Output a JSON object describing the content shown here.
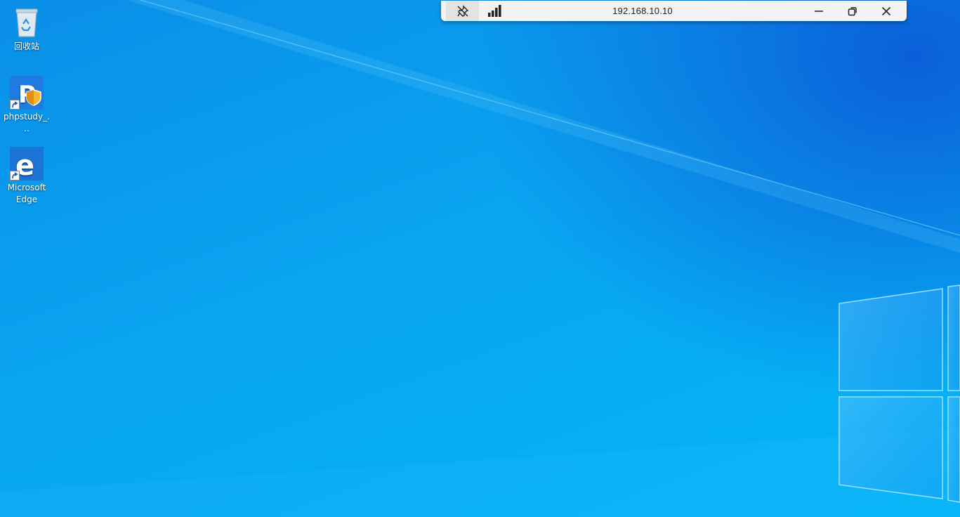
{
  "desktop": {
    "icons": [
      {
        "label": "回收站",
        "icon": "recycle-bin-icon"
      },
      {
        "label": "phpstudy_...",
        "icon": "phpstudy-icon"
      },
      {
        "label": "Microsoft Edge",
        "icon": "edge-icon"
      }
    ]
  },
  "remote_bar": {
    "title": "192.168.10.10",
    "icons": {
      "pin": "pin-icon",
      "signal": "signal-strength-icon",
      "minimize": "minimize-icon",
      "restore": "restore-icon",
      "close": "close-icon"
    }
  },
  "colors": {
    "wallpaper_light": "#03b6f8",
    "wallpaper_dark": "#0a5fd8",
    "bar_bg": "#f3f3f3"
  }
}
